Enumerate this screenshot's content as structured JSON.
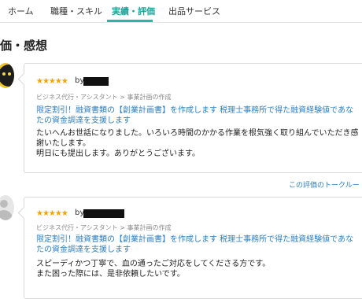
{
  "tabs": [
    {
      "label": "ホーム",
      "active": false
    },
    {
      "label": "職種・スキル",
      "active": false
    },
    {
      "label": "実績・評価",
      "active": true
    },
    {
      "label": "出品サービス",
      "active": false
    }
  ],
  "section_title": "価・感想",
  "reviews": [
    {
      "stars": "★★★★★",
      "by": "by",
      "reviewer_name_redacted": true,
      "category": "ビジネス代行・アシスタント > 事業計画の作成",
      "service_link": "限定割引！融資書類の【創業計画書】を作成します 税理士事務所で得た融資経験値であなたの資金調達を支援します",
      "comment": "たいへんお世話になりました。いろいろ時間のかかる作業を根気強く取り組んでいただき感謝いたします。\n明日にも提出します。ありがとうございます。",
      "avatar": "cat-avatar"
    },
    {
      "stars": "★★★★★",
      "by": "by",
      "reviewer_name_redacted": true,
      "category": "ビジネス代行・アシスタント > 事業計画の作成",
      "service_link": "限定割引！融資書類の【創業計画書】を作成します 税理士事務所で得た融資経験値であなたの資金調達を支援します",
      "comment": "スピーディかつ丁寧で、血の通ったご対応をしてくださる方です。\nまた困った際には、是非依頼したいです。",
      "avatar": "default-user-avatar"
    }
  ],
  "talk_room_link": "この評価のトークルー",
  "colors": {
    "accent": "#2bb5a6",
    "link": "#2d7fbf",
    "star": "#f2a20f"
  }
}
